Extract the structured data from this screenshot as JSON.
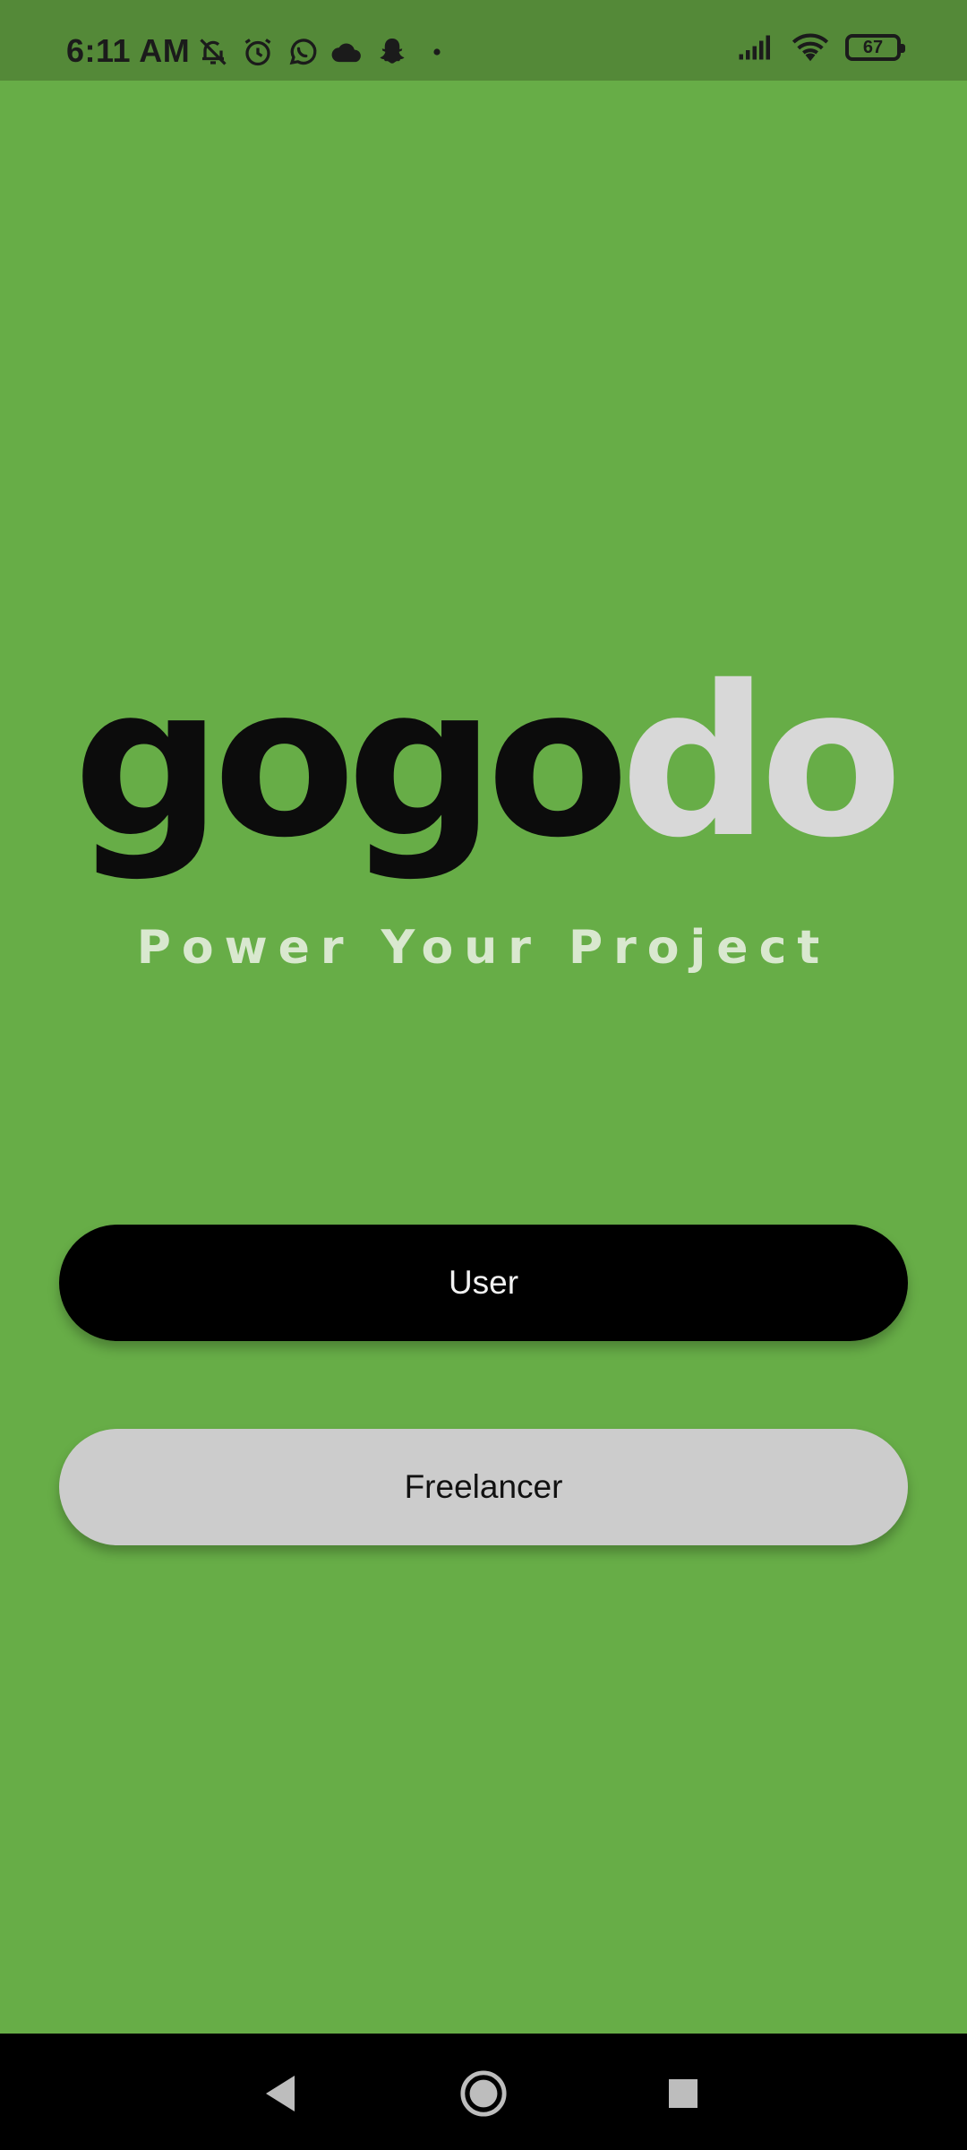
{
  "status_bar": {
    "time": "6:11 AM",
    "icons_left": [
      "muted-bell-icon",
      "alarm-icon",
      "whatsapp-icon",
      "cloud-icon",
      "snapchat-icon",
      "dot-icon"
    ],
    "icons_right": [
      "signal-icon",
      "wifi-icon",
      "battery-icon"
    ],
    "battery_level": "67"
  },
  "logo": {
    "part_dark": "gogo",
    "part_light": "do",
    "tagline": "Power Your Project"
  },
  "buttons": {
    "user_label": "User",
    "freelancer_label": "Freelancer"
  },
  "nav_bar": {
    "icons": [
      "back-icon",
      "home-icon",
      "recents-icon"
    ]
  },
  "colors": {
    "background": "#67ad47",
    "status_bar": "#548938",
    "user_button": "#000000",
    "freelancer_button": "#cccccc",
    "logo_light": "#d8d8d8"
  }
}
